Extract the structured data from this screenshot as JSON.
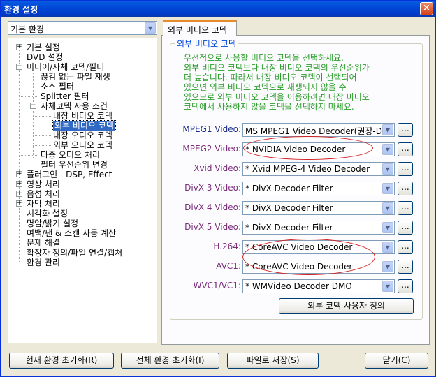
{
  "window": {
    "title": "환경 설정",
    "close_glyph": "×"
  },
  "left": {
    "preset_selected": "기본 환경",
    "tree": [
      {
        "label": "기본 설정",
        "expander": "+"
      },
      {
        "label": "DVD 설정"
      },
      {
        "label": "미디어/자체 코덱/필터",
        "expander": "−"
      },
      {
        "label": "끊김 없는 파일 재생"
      },
      {
        "label": "소스 필터"
      },
      {
        "label": "Splitter 필터"
      },
      {
        "label": "자체코덱 사용 조건",
        "expander": "−"
      },
      {
        "label": "내장 비디오 코덱"
      },
      {
        "label": "외부 비디오 코덱",
        "selected": true
      },
      {
        "label": "내장 오디오 코덱"
      },
      {
        "label": "외부 오디오 코덱"
      },
      {
        "label": "다중 오디오 처리"
      },
      {
        "label": "필터 우선순위 변경"
      },
      {
        "label": "플러그인 - DSP, Effect",
        "expander": "+"
      },
      {
        "label": "영상 처리",
        "expander": "+"
      },
      {
        "label": "음성 처리",
        "expander": "+"
      },
      {
        "label": "자막 처리",
        "expander": "+"
      },
      {
        "label": "시각화 설정"
      },
      {
        "label": "명암/밝기 설정"
      },
      {
        "label": "여백/팬 & 스캔 자동 계산"
      },
      {
        "label": "문제 해결"
      },
      {
        "label": "확장자 정의/파일 연결/캡처"
      },
      {
        "label": "환경 관리"
      }
    ]
  },
  "right": {
    "tab_label": "외부 비디오 코덱",
    "group_label": "외부 비디오 코덱",
    "description": [
      "우선적으로 사용할 비디오 코덱을 선택하세요.",
      "외부 비디오 코덱보다 내장 비디오 코덱의 우선순위가",
      "더 높습니다. 따라서 내장 비디오 코덱이 선택되어",
      "있으면 외부 비디오 코덱으로 재생되지 않을 수",
      "있으므로 외부 비디오 코덱을 이용하려면 내장 비디오",
      "코덱에서 사용하지 않을 코덱을 선택하지 마세요."
    ],
    "codecs": [
      {
        "label": "MPEG1 Video:",
        "value": "MS MPEG1 Video Decoder(권장-D",
        "dots": "..."
      },
      {
        "label": "MPEG2 Video:",
        "value": "* NVIDIA Video Decoder",
        "dots": "..."
      },
      {
        "label": "Xvid Video:",
        "value": "* Xvid MPEG-4 Video Decoder",
        "dots": "..."
      },
      {
        "label": "DivX 3 Video:",
        "value": "* DivX Decoder Filter",
        "dots": "..."
      },
      {
        "label": "DivX 4 Video:",
        "value": "* DivX Decoder Filter",
        "dots": "..."
      },
      {
        "label": "DivX 5 Video:",
        "value": "* DivX Decoder Filter",
        "dots": "..."
      },
      {
        "label": "H.264:",
        "value": "* CoreAVC Video Decoder",
        "dots": "..."
      },
      {
        "label": "AVC1:",
        "value": "* CoreAVC Video Decoder",
        "dots": "..."
      },
      {
        "label": "WVC1/VC1:",
        "value": "* WMVideo Decoder DMO",
        "dots": "..."
      }
    ],
    "custom_button": "외부 코덱 사용자 정의"
  },
  "footer": {
    "reset_current": "현재 환경 초기화(R)",
    "reset_all": "전체 환경 초기화(I)",
    "save_file": "파일로 저장(S)",
    "close": "닫기(C)"
  },
  "colors": {
    "accent_green": "#2b9d2b",
    "label_purple": "#7a2c7a",
    "highlight": "#316ac5",
    "annotation_red": "#d42020"
  }
}
